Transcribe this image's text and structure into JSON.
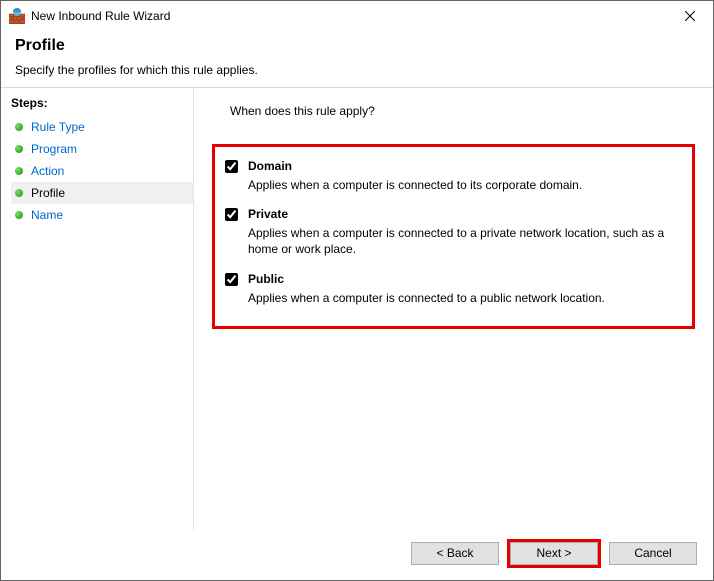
{
  "window": {
    "title": "New Inbound Rule Wizard"
  },
  "header": {
    "title": "Profile",
    "subtitle": "Specify the profiles for which this rule applies."
  },
  "sidebar": {
    "label": "Steps:",
    "items": [
      {
        "label": "Rule Type"
      },
      {
        "label": "Program"
      },
      {
        "label": "Action"
      },
      {
        "label": "Profile"
      },
      {
        "label": "Name"
      }
    ],
    "current": 3
  },
  "content": {
    "question": "When does this rule apply?",
    "options": [
      {
        "name": "Domain",
        "desc": "Applies when a computer is connected to its corporate domain.",
        "checked": true
      },
      {
        "name": "Private",
        "desc": "Applies when a computer is connected to a private network location, such as a home or work place.",
        "checked": true
      },
      {
        "name": "Public",
        "desc": "Applies when a computer is connected to a public network location.",
        "checked": true
      }
    ]
  },
  "footer": {
    "back": "< Back",
    "next": "Next >",
    "cancel": "Cancel"
  }
}
